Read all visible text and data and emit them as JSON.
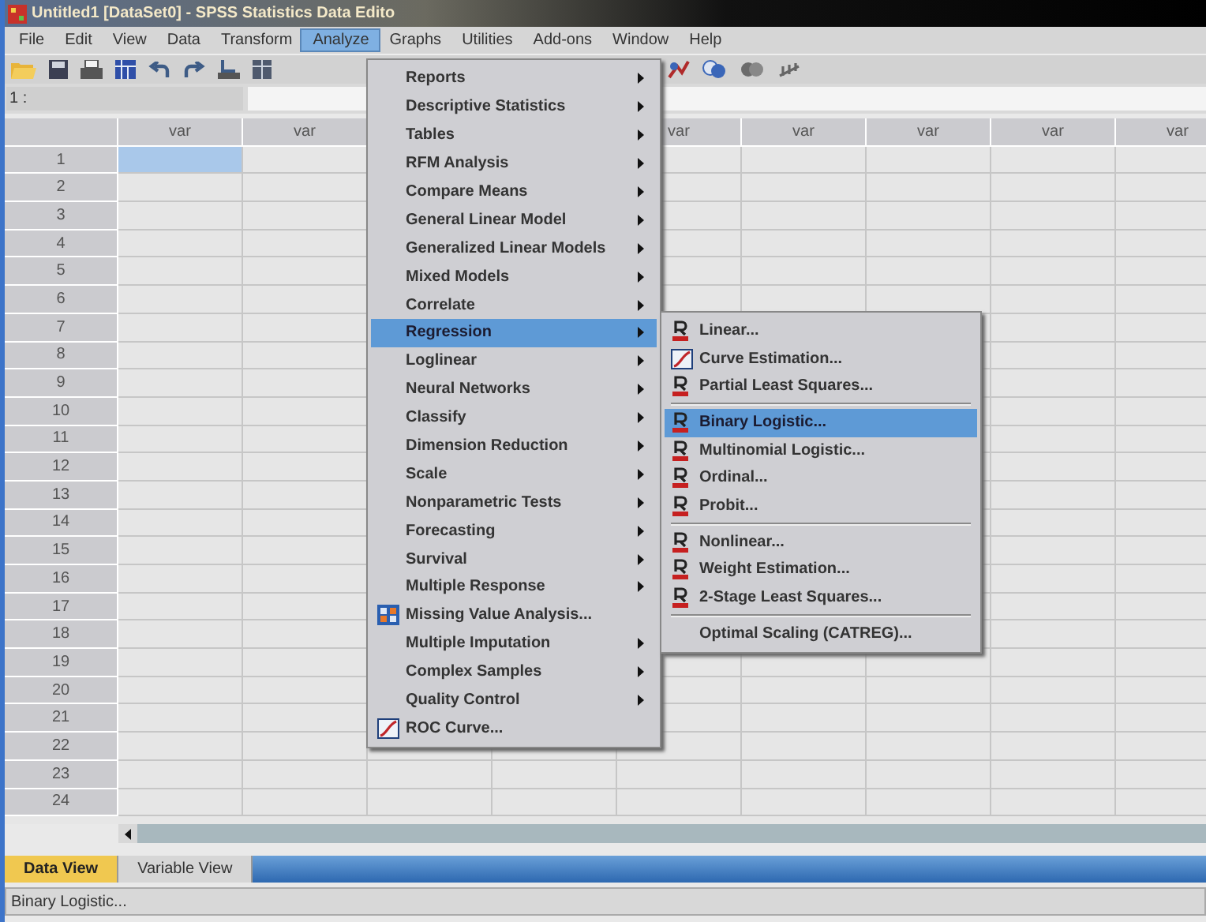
{
  "window": {
    "title": "Untitled1 [DataSet0] - SPSS Statistics Data Edito"
  },
  "menu_bar": [
    {
      "label": "File",
      "selected": false
    },
    {
      "label": "Edit",
      "selected": false
    },
    {
      "label": "View",
      "selected": false
    },
    {
      "label": "Data",
      "selected": false
    },
    {
      "label": "Transform",
      "selected": false
    },
    {
      "label": "Analyze",
      "selected": true
    },
    {
      "label": "Graphs",
      "selected": false
    },
    {
      "label": "Utilities",
      "selected": false
    },
    {
      "label": "Add-ons",
      "selected": false
    },
    {
      "label": "Window",
      "selected": false
    },
    {
      "label": "Help",
      "selected": false
    }
  ],
  "cell_reference": "1 :",
  "grid": {
    "columns": [
      {
        "label": "var"
      },
      {
        "label": "var"
      },
      {},
      {},
      {
        "label": "var"
      },
      {
        "label": "var"
      },
      {
        "label": "var"
      },
      {
        "label": "var"
      },
      {
        "label": "var"
      }
    ],
    "rows": [
      {
        "label": "1",
        "selected": true
      },
      {
        "label": "2",
        "selected": false
      },
      {
        "label": "3",
        "selected": false
      },
      {
        "label": "4",
        "selected": false
      },
      {
        "label": "5",
        "selected": false
      },
      {
        "label": "6",
        "selected": false
      },
      {
        "label": "7",
        "selected": false
      },
      {
        "label": "8",
        "selected": false
      },
      {
        "label": "9",
        "selected": false
      },
      {
        "label": "10",
        "selected": false
      },
      {
        "label": "11",
        "selected": false
      },
      {
        "label": "12",
        "selected": false
      },
      {
        "label": "13",
        "selected": false
      },
      {
        "label": "14",
        "selected": false
      },
      {
        "label": "15",
        "selected": false
      },
      {
        "label": "16",
        "selected": false
      },
      {
        "label": "17",
        "selected": false
      },
      {
        "label": "18",
        "selected": false
      },
      {
        "label": "19",
        "selected": false
      },
      {
        "label": "20",
        "selected": false
      },
      {
        "label": "21",
        "selected": false
      },
      {
        "label": "22",
        "selected": false
      },
      {
        "label": "23",
        "selected": false
      },
      {
        "label": "24",
        "selected": false
      }
    ]
  },
  "analyze_menu": [
    {
      "label": "Reports",
      "kind": "submenu",
      "selected": false
    },
    {
      "label": "Descriptive Statistics",
      "kind": "submenu",
      "selected": false
    },
    {
      "label": "Tables",
      "kind": "submenu",
      "selected": false
    },
    {
      "label": "RFM Analysis",
      "kind": "submenu",
      "selected": false
    },
    {
      "label": "Compare Means",
      "kind": "submenu",
      "selected": false
    },
    {
      "label": "General Linear Model",
      "kind": "submenu",
      "selected": false
    },
    {
      "label": "Generalized Linear Models",
      "kind": "submenu",
      "selected": false
    },
    {
      "label": "Mixed Models",
      "kind": "submenu",
      "selected": false
    },
    {
      "label": "Correlate",
      "kind": "submenu",
      "selected": false
    },
    {
      "label": "Regression",
      "kind": "submenu",
      "selected": true
    },
    {
      "label": "Loglinear",
      "kind": "submenu",
      "selected": false
    },
    {
      "label": "Neural Networks",
      "kind": "submenu",
      "selected": false
    },
    {
      "label": "Classify",
      "kind": "submenu",
      "selected": false
    },
    {
      "label": "Dimension Reduction",
      "kind": "submenu",
      "selected": false
    },
    {
      "label": "Scale",
      "kind": "submenu",
      "selected": false
    },
    {
      "label": "Nonparametric Tests",
      "kind": "submenu",
      "selected": false
    },
    {
      "label": "Forecasting",
      "kind": "submenu",
      "selected": false
    },
    {
      "label": "Survival",
      "kind": "submenu",
      "selected": false
    },
    {
      "label": "Multiple Response",
      "kind": "submenu",
      "selected": false
    },
    {
      "label": "Missing Value Analysis...",
      "kind": "matrix",
      "selected": false
    },
    {
      "label": "Multiple Imputation",
      "kind": "submenu",
      "selected": false
    },
    {
      "label": "Complex Samples",
      "kind": "submenu",
      "selected": false
    },
    {
      "label": "Quality Control",
      "kind": "submenu",
      "selected": false
    },
    {
      "label": "ROC Curve...",
      "kind": "curve",
      "selected": false
    }
  ],
  "regression_submenu": [
    {
      "label": "Linear...",
      "kind": "regression",
      "selected": false
    },
    {
      "label": "Curve Estimation...",
      "kind": "curve",
      "selected": false
    },
    {
      "label": "Partial Least Squares...",
      "kind": "regression",
      "selected": false
    },
    {
      "kind": "separator"
    },
    {
      "label": "Binary Logistic...",
      "kind": "regression",
      "selected": true
    },
    {
      "label": "Multinomial Logistic...",
      "kind": "regression",
      "selected": false
    },
    {
      "label": "Ordinal...",
      "kind": "regression",
      "selected": false
    },
    {
      "label": "Probit...",
      "kind": "regression",
      "selected": false
    },
    {
      "kind": "separator"
    },
    {
      "label": "Nonlinear...",
      "kind": "regression",
      "selected": false
    },
    {
      "label": "Weight Estimation...",
      "kind": "regression",
      "selected": false
    },
    {
      "label": "2-Stage Least Squares...",
      "kind": "regression",
      "selected": false
    },
    {
      "kind": "separator"
    },
    {
      "label": "Optimal Scaling (CATREG)...",
      "kind": "dialog",
      "selected": false
    }
  ],
  "view_tabs": [
    {
      "label": "Data View",
      "selected": true
    },
    {
      "label": "Variable View",
      "selected": false
    }
  ],
  "status_bar": "Binary Logistic..."
}
